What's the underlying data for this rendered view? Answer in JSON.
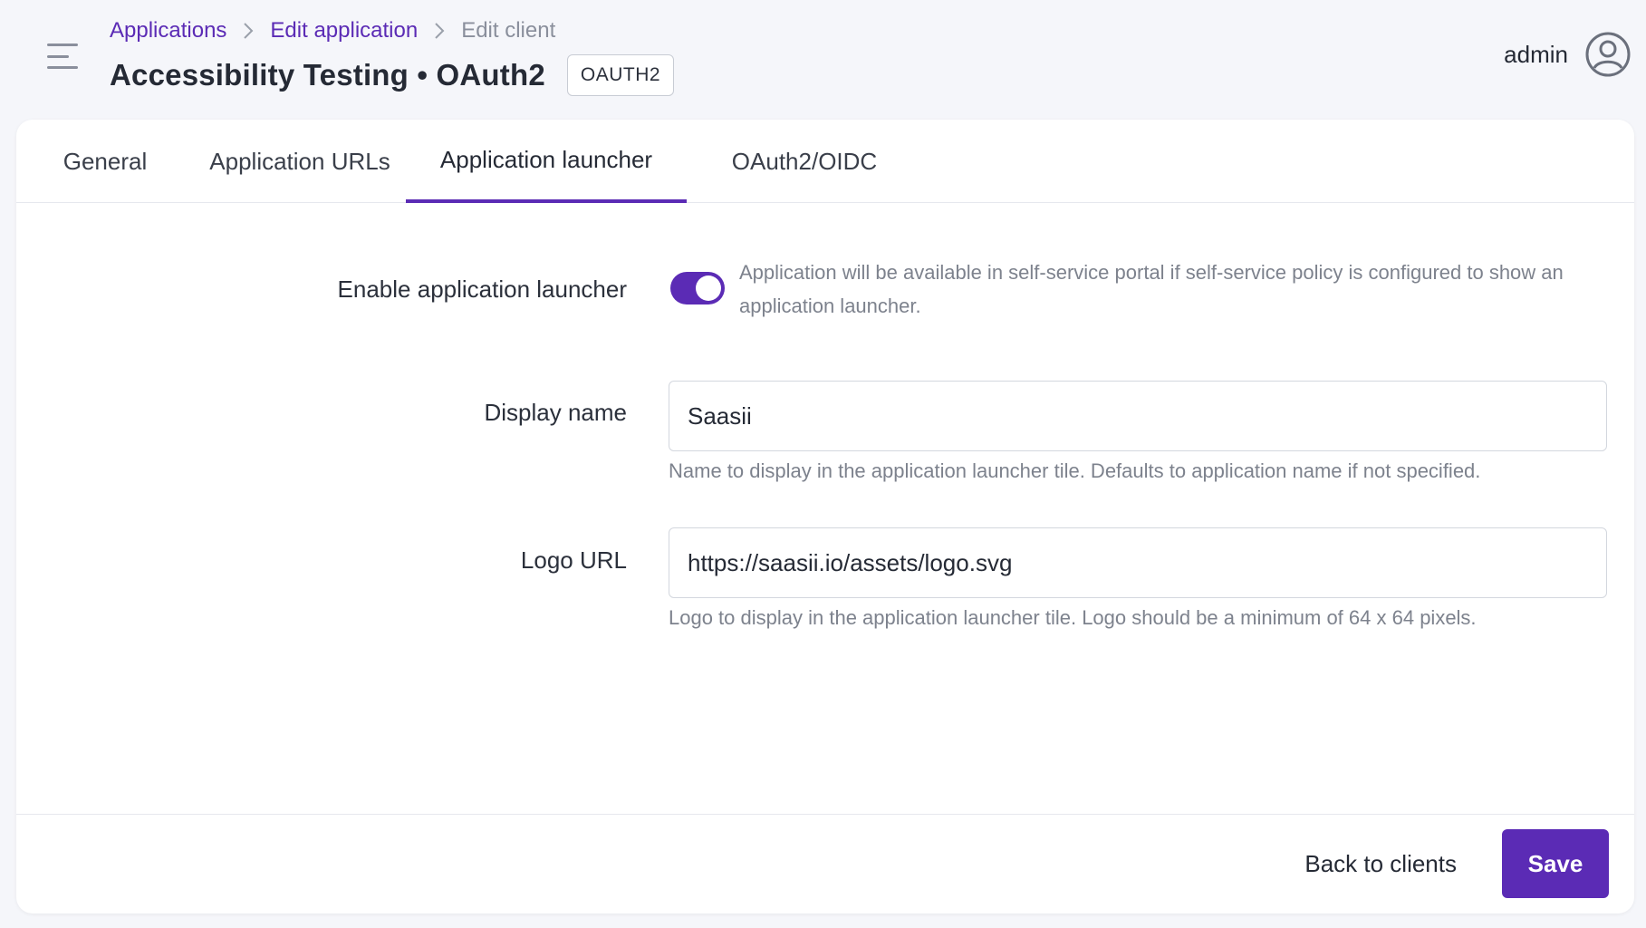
{
  "header": {
    "breadcrumb": {
      "item1": "Applications",
      "item2": "Edit application",
      "current": "Edit client"
    },
    "title": "Accessibility Testing • OAuth2",
    "badge": "OAUTH2",
    "user": "admin"
  },
  "tabs": [
    {
      "label": "General",
      "active": false
    },
    {
      "label": "Application URLs",
      "active": false
    },
    {
      "label": "Application launcher",
      "active": true
    },
    {
      "label": "OAuth2/OIDC",
      "active": false
    }
  ],
  "form": {
    "enable_launcher": {
      "label": "Enable application launcher",
      "enabled": true,
      "help": "Application will be available in self-service portal if self-service policy is configured to show an application launcher."
    },
    "display_name": {
      "label": "Display name",
      "value": "Saasii",
      "help": "Name to display in the application launcher tile. Defaults to application name if not specified."
    },
    "logo_url": {
      "label": "Logo URL",
      "value": "https://saasii.io/assets/logo.svg",
      "help": "Logo to display in the application launcher tile. Logo should be a minimum of 64 x 64 pixels."
    }
  },
  "footer": {
    "back_label": "Back to clients",
    "save_label": "Save"
  },
  "colors": {
    "accent": "#5b2bb5",
    "background": "#f5f6fa"
  },
  "icons": {
    "menu": "hamburger-menu-icon",
    "separator": "chevron-right-icon",
    "avatar": "user-circle-icon"
  }
}
